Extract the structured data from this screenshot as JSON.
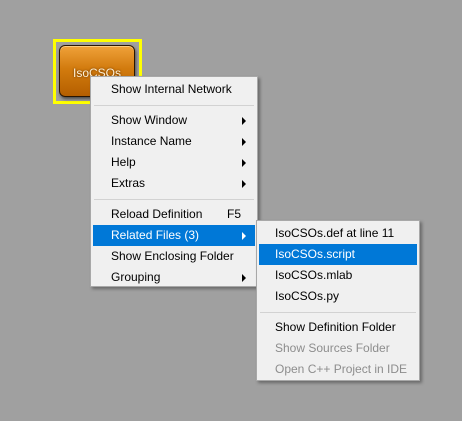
{
  "module": {
    "label": "IsoCSOs",
    "selection_color": "#ffff00",
    "node_color": "#d27b0e"
  },
  "context_menu": {
    "items": [
      {
        "label": "Show Internal Network"
      },
      {
        "label": "Show Window",
        "submenu": true
      },
      {
        "label": "Instance Name",
        "submenu": true
      },
      {
        "label": "Help",
        "submenu": true
      },
      {
        "label": "Extras",
        "submenu": true
      },
      {
        "label": "Reload Definition",
        "shortcut": "F5"
      },
      {
        "label": "Related Files (3)",
        "submenu": true,
        "highlighted": true
      },
      {
        "label": "Show Enclosing Folder"
      },
      {
        "label": "Grouping",
        "submenu": true
      }
    ]
  },
  "related_files_submenu": {
    "items": [
      {
        "label": "IsoCSOs.def at line 11"
      },
      {
        "label": "IsoCSOs.script",
        "highlighted": true
      },
      {
        "label": "IsoCSOs.mlab"
      },
      {
        "label": "IsoCSOs.py"
      },
      {
        "label": "Show Definition Folder"
      },
      {
        "label": "Show Sources Folder",
        "disabled": true
      },
      {
        "label": "Open C++ Project in IDE",
        "disabled": true
      }
    ]
  },
  "colors": {
    "highlight": "#0078d7",
    "menu_bg": "#f0f0f0",
    "canvas_bg": "#a0a0a0",
    "disabled_text": "#8d8d8d"
  }
}
